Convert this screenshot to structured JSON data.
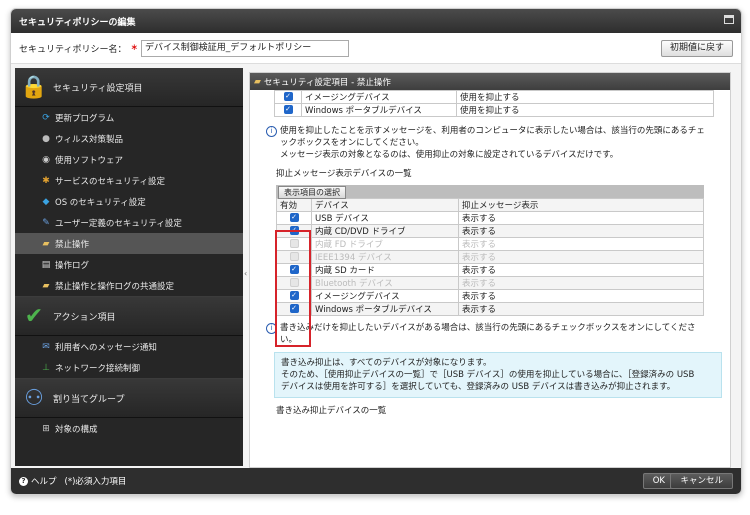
{
  "window": {
    "title": "セキュリティポリシーの編集"
  },
  "policy_name": {
    "label": "セキュリティポリシー名：",
    "required_mark": "∗",
    "value": "デバイス制御検証用_デフォルトポリシー",
    "reset_label": "初期値に戻す"
  },
  "sidebar": {
    "header1": "セキュリティ設定項目",
    "items1": [
      {
        "label": "更新プログラム",
        "icon": "update-icon"
      },
      {
        "label": "ウィルス対策製品",
        "icon": "antivirus-icon"
      },
      {
        "label": "使用ソフトウェア",
        "icon": "software-icon"
      },
      {
        "label": "サービスのセキュリティ設定",
        "icon": "service-icon"
      },
      {
        "label": "OS のセキュリティ設定",
        "icon": "os-icon"
      },
      {
        "label": "ユーザー定義のセキュリティ設定",
        "icon": "user-defined-icon"
      },
      {
        "label": "禁止操作",
        "icon": "prohibited-icon"
      },
      {
        "label": "操作ログ",
        "icon": "log-icon"
      },
      {
        "label": "禁止操作と操作ログの共通設定",
        "icon": "common-settings-icon"
      }
    ],
    "header2": "アクション項目",
    "items2": [
      {
        "label": "利用者へのメッセージ通知",
        "icon": "message-icon"
      },
      {
        "label": "ネットワーク接続制御",
        "icon": "network-icon"
      }
    ],
    "header3": "割り当てグループ",
    "items3": [
      {
        "label": "対象の構成",
        "icon": "structure-icon"
      }
    ]
  },
  "panel": {
    "title": "セキュリティ設定項目 - 禁止操作",
    "top_rows": [
      {
        "device": "イメージングデバイス",
        "setting": "使用を抑止する"
      },
      {
        "device": "Windows ポータブルデバイス",
        "setting": "使用を抑止する"
      }
    ],
    "info1": [
      "使用を抑止したことを示すメッセージを、利用者のコンピュータに表示したい場合は、該当行の先頭にあるチェ",
      "ックボックスをオンにしてください。",
      "メッセージ表示の対象となるのは、使用抑止の対象に設定されているデバイスだけです。"
    ],
    "list_title": "抑止メッセージ表示デバイスの一覧",
    "select_button": "表示項目の選択",
    "columns": [
      "有効",
      "デバイス",
      "抑止メッセージ表示"
    ],
    "rows": [
      {
        "checked": true,
        "device": "USB デバイス",
        "msg": "表示する",
        "dim": false
      },
      {
        "checked": true,
        "device": "内蔵 CD/DVD ドライブ",
        "msg": "表示する",
        "dim": false
      },
      {
        "checked": false,
        "device": "内蔵 FD ドライブ",
        "msg": "表示する",
        "dim": true
      },
      {
        "checked": false,
        "device": "IEEE1394 デバイス",
        "msg": "表示する",
        "dim": true
      },
      {
        "checked": true,
        "device": "内蔵 SD カード",
        "msg": "表示する",
        "dim": false
      },
      {
        "checked": false,
        "device": "Bluetooth デバイス",
        "msg": "表示する",
        "dim": true
      },
      {
        "checked": true,
        "device": "イメージングデバイス",
        "msg": "表示する",
        "dim": false
      },
      {
        "checked": true,
        "device": "Windows ポータブルデバイス",
        "msg": "表示する",
        "dim": false
      }
    ],
    "info2": [
      "書き込みだけを抑止したいデバイスがある場合は、該当行の先頭にあるチェックボックスをオンにしてくださ",
      "い。"
    ],
    "note": [
      "書き込み抑止は、すべてのデバイスが対象になります。",
      "そのため、［使用抑止デバイスの一覧］で［USB デバイス］の使用を抑止している場合に、［登録済みの USB",
      "デバイスは使用を許可する］を選択していても、登録済みの USB デバイスは書き込みが抑止されます。"
    ],
    "write_title": "書き込み抑止デバイスの一覧"
  },
  "footer": {
    "help": "ヘルプ",
    "required_note": "(*)必須入力項目",
    "ok": "OK",
    "cancel": "キャンセル"
  },
  "colors": {
    "accent_blue": "#1f66c9",
    "highlight_red": "#d6232a",
    "dark": "#262626"
  }
}
